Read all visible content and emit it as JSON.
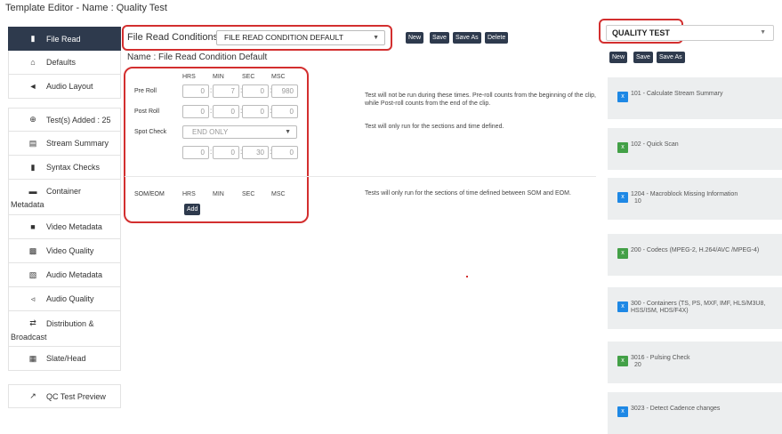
{
  "title": "Template Editor - Name : Quality Test",
  "sidebar": {
    "items": [
      {
        "label": "File Read",
        "icon": "file-icon"
      },
      {
        "label": "Defaults",
        "icon": "home-icon"
      },
      {
        "label": "Audio Layout",
        "icon": "megaphone-icon"
      },
      {
        "label": "Test(s) Added : 25",
        "icon": "plus-circle-icon"
      },
      {
        "label": "Stream Summary",
        "icon": "list-icon"
      },
      {
        "label": "Syntax Checks",
        "icon": "file-icon"
      },
      {
        "label": "Container",
        "label2": "Metadata",
        "icon": "folder-icon"
      },
      {
        "label": "Video Metadata",
        "icon": "video-icon"
      },
      {
        "label": "Video Quality",
        "icon": "film-icon"
      },
      {
        "label": "Audio Metadata",
        "icon": "audio-file-icon"
      },
      {
        "label": "Audio Quality",
        "icon": "volume-icon"
      },
      {
        "label": "Distribution &",
        "label2": "Broadcast",
        "icon": "shuffle-icon"
      },
      {
        "label": "Slate/Head",
        "icon": "grid-icon"
      },
      {
        "label": "QC Test Preview",
        "icon": "external-link-icon"
      }
    ]
  },
  "file_read": {
    "label": "File Read Conditions",
    "selected": "FILE READ CONDITION DEFAULT",
    "name_line": "Name : File Read Condition Default",
    "buttons": {
      "new": "New",
      "save": "Save",
      "save_as": "Save As",
      "delete": "Delete"
    }
  },
  "time_grid": {
    "headers": [
      "HRS",
      "MIN",
      "SEC",
      "MSC"
    ],
    "pre_roll": {
      "label": "Pre Roll",
      "values": [
        "0",
        "7",
        "0",
        "980"
      ]
    },
    "post_roll": {
      "label": "Post Roll",
      "values": [
        "0",
        "0",
        "0",
        "0"
      ]
    },
    "spot_check": {
      "label": "Spot Check",
      "selected": "END ONLY",
      "values": [
        "0",
        "0",
        "30",
        "0"
      ]
    },
    "som_eom": {
      "label": "SOM/EOM",
      "add_label": "Add"
    }
  },
  "notes": {
    "roll": "Test will not be run during these times. Pre-roll counts from the beginning of the clip, while Post-roll counts from the end of the clip.",
    "spot": "Test will only run for the sections and time defined.",
    "som": "Tests will only run for the sections of time defined between SOM and EOM."
  },
  "template": {
    "selected": "QUALITY TEST",
    "buttons": {
      "new": "New",
      "save": "Save",
      "save_as": "Save As"
    },
    "cards": [
      {
        "text": "101 - Calculate Stream Summary",
        "color": "blue"
      },
      {
        "text": "102 - Quick Scan",
        "color": "green"
      },
      {
        "text": "1204 - Macroblock Missing Information",
        "sub": "10",
        "color": "blue"
      },
      {
        "text": "200 - Codecs (MPEG-2, H.264/AVC /MPEG-4)",
        "color": "green"
      },
      {
        "text": "300 - Containers (TS, PS, MXF, IMF, HLS/M3U8, HSS/ISM, HDS/F4X)",
        "color": "blue"
      },
      {
        "text": "3016 - Pulsing Check",
        "sub": "20",
        "color": "green"
      },
      {
        "text": "3023 - Detect Cadence changes",
        "color": "blue"
      }
    ],
    "badge_glyph": "x"
  },
  "colors": {
    "accent": "#2e3a4d",
    "highlight": "#d32f2f",
    "badge_blue": "#1e88e5",
    "badge_green": "#43a047"
  }
}
